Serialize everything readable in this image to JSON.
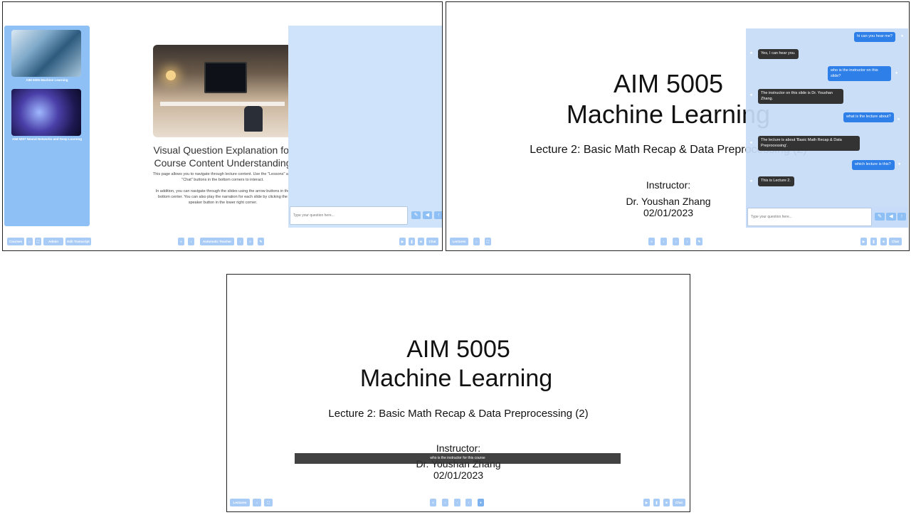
{
  "panel1": {
    "sidebar": {
      "courses": [
        {
          "label": "AIM 5005 Machine Learning"
        },
        {
          "label": "AIM 5007 Neural Networks and Deep Learning"
        }
      ]
    },
    "main": {
      "title": "Visual Question Explanation for Course Content Understanding",
      "desc1": "This page allows you to navigate through lecture content. Use the \"Lessons\" and \"Chat\" buttons in the bottom corners to interact.",
      "desc2": "In addition, you can navigate through the slides using the arrow buttons in the bottom center. You can also play the narration for each slide by clicking the speaker button in the lower right corner."
    },
    "chat": {
      "placeholder": "Type your question here..."
    },
    "bottom": {
      "courses_label": "Courses",
      "admin_label": "Admin",
      "edit_transcript_label": "Edit Transcript",
      "auto_teacher_label": "Automatic Teacher",
      "chat_label": "Chat"
    }
  },
  "slide": {
    "course_code": "AIM 5005",
    "course_name": "Machine Learning",
    "lecture": "Lecture 2: Basic Math Recap & Data Preprocessing (2)",
    "instructor_label": "Instructor:",
    "instructor_name": "Dr. Youshan Zhang",
    "date": "02/01/2023"
  },
  "panel2": {
    "chat": {
      "placeholder": "Type your question here...",
      "messages": [
        {
          "role": "user",
          "text": "hi can you hear me?"
        },
        {
          "role": "bot",
          "text": "Yes, I can hear you."
        },
        {
          "role": "user",
          "text": "who is the instructor on this slide?"
        },
        {
          "role": "bot",
          "text": "The instructor on this slide is Dr. Youshan Zhang."
        },
        {
          "role": "user",
          "text": "what is the lecture about?"
        },
        {
          "role": "bot",
          "text": "The lecture is about 'Basic Math Recap & Data Preprocessing'."
        },
        {
          "role": "user",
          "text": "which lecture is this?"
        },
        {
          "role": "bot",
          "text": "This is Lecture 2."
        }
      ]
    },
    "bottom": {
      "lectures_label": "Lectures",
      "chat_label": "Chat"
    }
  },
  "panel3": {
    "caption": "who is the instructor for this course",
    "bottom": {
      "lectures_label": "Lectures",
      "chat_label": "Chat"
    }
  },
  "colors": {
    "accent": "#8fc0f5",
    "user_bubble": "#2f7fe8",
    "bot_bubble": "#333333",
    "chat_bg": "#c6dcf8"
  }
}
